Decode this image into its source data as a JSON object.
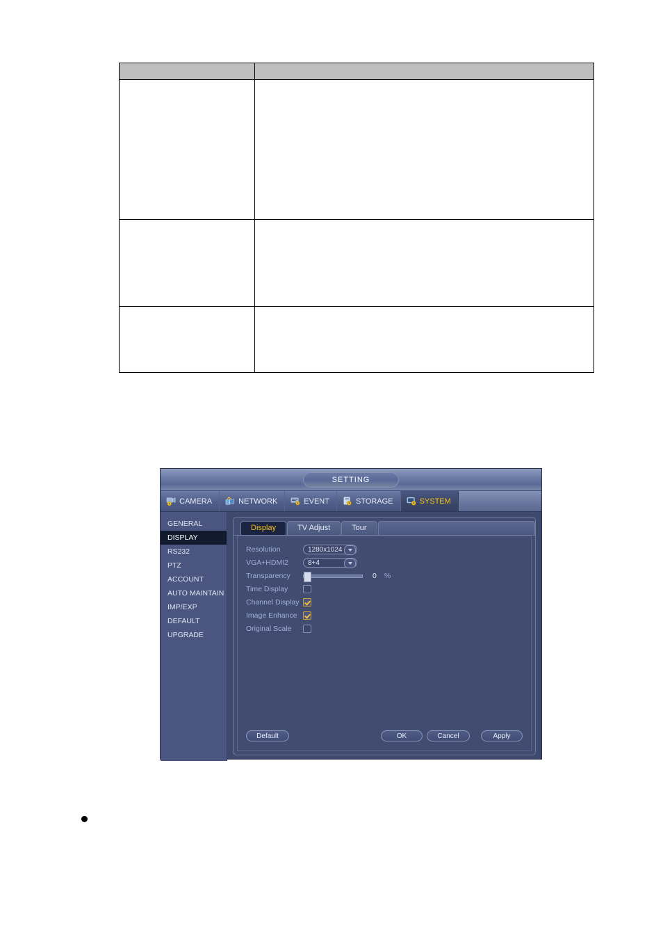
{
  "document": {
    "table": {
      "headers": [
        "",
        ""
      ],
      "rows": [
        {
          "cells": [
            "",
            ""
          ]
        },
        {
          "cells": [
            "",
            ""
          ]
        },
        {
          "cells": [
            "",
            ""
          ]
        }
      ]
    },
    "bullet_text": ""
  },
  "dialog": {
    "title": "SETTING",
    "menu_tabs": [
      {
        "label": "CAMERA",
        "icon": "camera-icon",
        "active": false
      },
      {
        "label": "NETWORK",
        "icon": "network-icon",
        "active": false
      },
      {
        "label": "EVENT",
        "icon": "event-icon",
        "active": false
      },
      {
        "label": "STORAGE",
        "icon": "storage-icon",
        "active": false
      },
      {
        "label": "SYSTEM",
        "icon": "system-icon",
        "active": true
      }
    ],
    "sidebar": {
      "items": [
        {
          "label": "GENERAL",
          "selected": false
        },
        {
          "label": "DISPLAY",
          "selected": true
        },
        {
          "label": "RS232",
          "selected": false
        },
        {
          "label": "PTZ",
          "selected": false
        },
        {
          "label": "ACCOUNT",
          "selected": false
        },
        {
          "label": "AUTO MAINTAIN",
          "selected": false
        },
        {
          "label": "IMP/EXP",
          "selected": false
        },
        {
          "label": "DEFAULT",
          "selected": false
        },
        {
          "label": "UPGRADE",
          "selected": false
        }
      ]
    },
    "subtabs": [
      {
        "label": "Display",
        "active": true
      },
      {
        "label": "TV Adjust",
        "active": false
      },
      {
        "label": "Tour",
        "active": false
      }
    ],
    "form": {
      "resolution": {
        "label": "Resolution",
        "value": "1280x1024"
      },
      "vga_hdmi2": {
        "label": "VGA+HDMI2",
        "value": "8+4"
      },
      "transparency": {
        "label": "Transparency",
        "value": "0",
        "unit": "%",
        "percent": 0
      },
      "time_display": {
        "label": "Time Display",
        "checked": false
      },
      "channel_display": {
        "label": "Channel Display",
        "checked": true
      },
      "image_enhance": {
        "label": "Image Enhance",
        "checked": true
      },
      "original_scale": {
        "label": "Original Scale",
        "checked": false
      }
    },
    "buttons": {
      "default_label": "Default",
      "ok_label": "OK",
      "cancel_label": "Cancel",
      "apply_label": "Apply"
    },
    "colors": {
      "window_bg": "#3e496b",
      "sidebar_bg": "#4a567f",
      "selected_item_bg": "#121a2e",
      "accent_yellow": "#f5c518",
      "label_blue": "#9fb0d8",
      "checkbox_check": "#f0c040"
    }
  }
}
